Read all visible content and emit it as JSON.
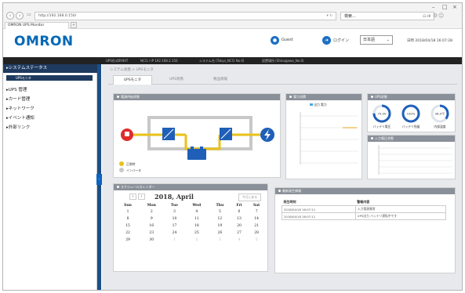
{
  "browser": {
    "address": "http://192.168.0.150/",
    "search_text": "検索...",
    "tab_title": "OMRON UPS Monitor"
  },
  "header": {
    "logo": "OMRON",
    "guest_label": "Guest",
    "login_label": "ログイン",
    "language": "日本語",
    "datetime": "日時 2018/04/18 16:07:28"
  },
  "infobar": {
    "model": "UPS形式BY80T",
    "ip": "NCI1 / IP 192.168.2.150",
    "system": "システム名 (Tokyo_NCI1 No.0)",
    "location": "設置場所 (Shinagawa_No.0)"
  },
  "sidebar": {
    "section": "システムステータス",
    "active_item": "UPSモニタ",
    "items": [
      "UPS 管理",
      "カード管理",
      "ネットワーク",
      "イベント通知",
      "外部リンク"
    ]
  },
  "breadcrumb": "システム状態 > UPSモニタ",
  "tabs": [
    "UPSモニタ",
    "UPS状態",
    "製品情報"
  ],
  "panels": {
    "flow_title": "電源供給状態",
    "legend_normal": "正常時",
    "legend_inverter": "インバータ",
    "meter_title": "電力消費",
    "meter_legend": "出力 電力",
    "status_title": "UPS状態",
    "status_items": [
      {
        "label": "バッテリ電圧",
        "value": "75.0V",
        "fill": 0.75
      },
      {
        "label": "バッテリ残量",
        "value": "100%",
        "fill": 1.0
      },
      {
        "label": "内部温度",
        "value": "36.0℃",
        "fill": 0.36
      }
    ],
    "graph_title": "入力電圧状態",
    "calendar_title": "スケジュールカレンダー",
    "calendar_button": "今月に戻る",
    "event_title": "最新発生情報",
    "event_headers": [
      "発生時刻",
      "警報内容"
    ],
    "events": [
      {
        "time": "2018/04/18 16:07:11",
        "text": "入力電源異常"
      },
      {
        "time": "2018/04/18 16:07:11",
        "text": "UPS出力 バッテリ運転中です"
      }
    ]
  },
  "calendar": {
    "month": "2018, April",
    "weekdays": [
      "Sun",
      "Mon",
      "Tue",
      "Wed",
      "Thu",
      "Fri",
      "Sat"
    ],
    "weeks": [
      [
        "1",
        "2",
        "3",
        "4",
        "5",
        "6",
        "7"
      ],
      [
        "8",
        "9",
        "10",
        "11",
        "12",
        "13",
        "14"
      ],
      [
        "15",
        "16",
        "17",
        "18",
        "19",
        "20",
        "21"
      ],
      [
        "22",
        "23",
        "24",
        "25",
        "26",
        "27",
        "28"
      ],
      [
        "29",
        "30",
        "1",
        "2",
        "3",
        "4",
        "5"
      ]
    ]
  },
  "colors": {
    "accent": "#0068b7",
    "panel_header": "#8a9099",
    "battery": "#1f5fb8",
    "power_line": "#e8c21a",
    "outlet": "#e02b2b"
  }
}
